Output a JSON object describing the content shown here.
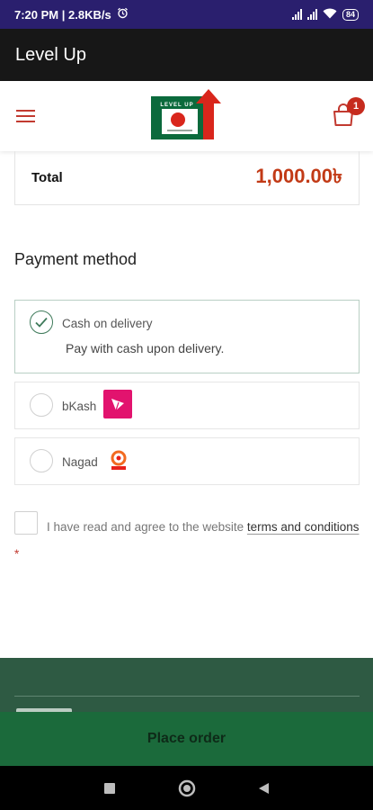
{
  "status_bar": {
    "time_speed": "7:20 PM | 2.8KB/s",
    "battery": "84"
  },
  "app_bar": {
    "title": "Level Up"
  },
  "header": {
    "cart_count": "1",
    "logo_text": "LEVEL UP"
  },
  "order": {
    "total_label": "Total",
    "total_value": "1,000.00৳"
  },
  "payment": {
    "title": "Payment method",
    "options": [
      {
        "label": "Cash on delivery",
        "description": "Pay with cash upon delivery.",
        "selected": true
      },
      {
        "label": "bKash",
        "selected": false
      },
      {
        "label": "Nagad",
        "selected": false
      }
    ]
  },
  "terms": {
    "text_before": "I have read and agree to the website ",
    "link": "terms and conditions",
    "required": "*"
  },
  "actions": {
    "place_order": "Place order"
  },
  "colors": {
    "accent_red": "#c23a16",
    "brand_green": "#1b6a3b",
    "footer_green": "#2e5a43",
    "status_bar": "#2a1f6e"
  }
}
